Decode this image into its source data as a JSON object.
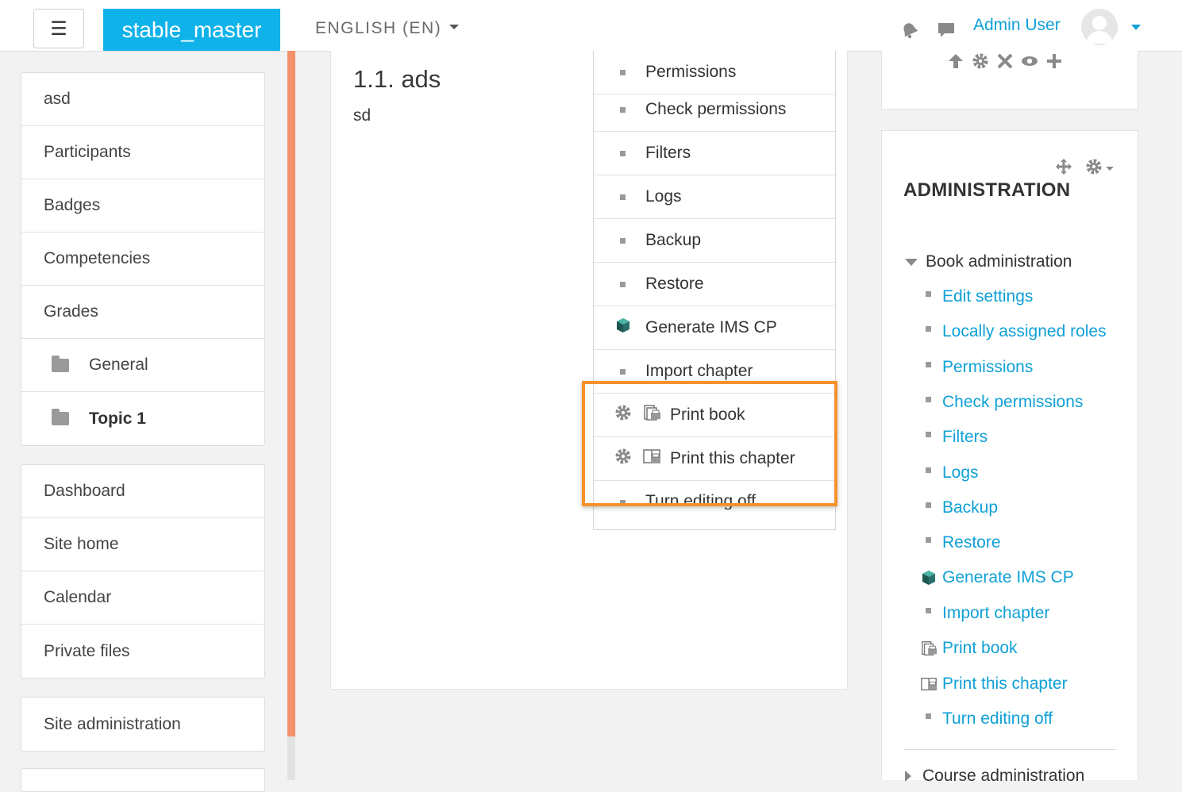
{
  "navbar": {
    "menu_glyph": "☰",
    "brand": "stable_master",
    "language": "ENGLISH (EN)",
    "user_name": "Admin User",
    "icons": [
      "bell-icon",
      "chat-icon",
      "avatar",
      "chevron-down-icon"
    ]
  },
  "left_nav": {
    "course_items": [
      {
        "label": "asd"
      },
      {
        "label": "Participants"
      },
      {
        "label": "Badges"
      },
      {
        "label": "Competencies"
      },
      {
        "label": "Grades"
      },
      {
        "label": "General",
        "icon": "folder-icon"
      },
      {
        "label": "Topic 1",
        "icon": "folder-icon"
      }
    ],
    "site_items": [
      {
        "label": "Dashboard"
      },
      {
        "label": "Site home"
      },
      {
        "label": "Calendar"
      },
      {
        "label": "Private files"
      }
    ],
    "admin_items": [
      {
        "label": "Site administration"
      }
    ]
  },
  "main": {
    "heading": "1.1. ads",
    "body": "sd"
  },
  "dropdown": {
    "items": [
      {
        "label": "Permissions",
        "icon": "bullet"
      },
      {
        "label": "Check permissions",
        "icon": "bullet"
      },
      {
        "label": "Filters",
        "icon": "bullet"
      },
      {
        "label": "Logs",
        "icon": "bullet"
      },
      {
        "label": "Backup",
        "icon": "bullet"
      },
      {
        "label": "Restore",
        "icon": "bullet"
      },
      {
        "label": "Generate IMS CP",
        "icon": "cube-icon"
      },
      {
        "label": "Import chapter",
        "icon": "bullet"
      },
      {
        "label": "Print book",
        "icon": "print-book-icon"
      },
      {
        "label": "Print this chapter",
        "icon": "print-chapter-icon"
      },
      {
        "label": "Turn editing off",
        "icon": "bullet"
      }
    ],
    "highlight_color": "#f5922b"
  },
  "admin_block": {
    "title": "ADMINISTRATION",
    "section": "Book administration",
    "items": [
      {
        "label": "Edit settings",
        "icon": "bullet"
      },
      {
        "label": "Locally assigned roles",
        "icon": "bullet"
      },
      {
        "label": "Permissions",
        "icon": "bullet"
      },
      {
        "label": "Check permissions",
        "icon": "bullet"
      },
      {
        "label": "Filters",
        "icon": "bullet"
      },
      {
        "label": "Logs",
        "icon": "bullet"
      },
      {
        "label": "Backup",
        "icon": "bullet"
      },
      {
        "label": "Restore",
        "icon": "bullet"
      },
      {
        "label": "Generate IMS CP",
        "icon": "cube-icon"
      },
      {
        "label": "Import chapter",
        "icon": "bullet"
      },
      {
        "label": "Print book",
        "icon": "print-book-icon"
      },
      {
        "label": "Print this chapter",
        "icon": "print-chapter-icon"
      },
      {
        "label": "Turn editing off",
        "icon": "bullet"
      }
    ],
    "next_section": "Course administration"
  },
  "colors": {
    "brand": "#0fb2e9",
    "link": "#0fa1d6",
    "drawer_accent": "#f4906a"
  }
}
